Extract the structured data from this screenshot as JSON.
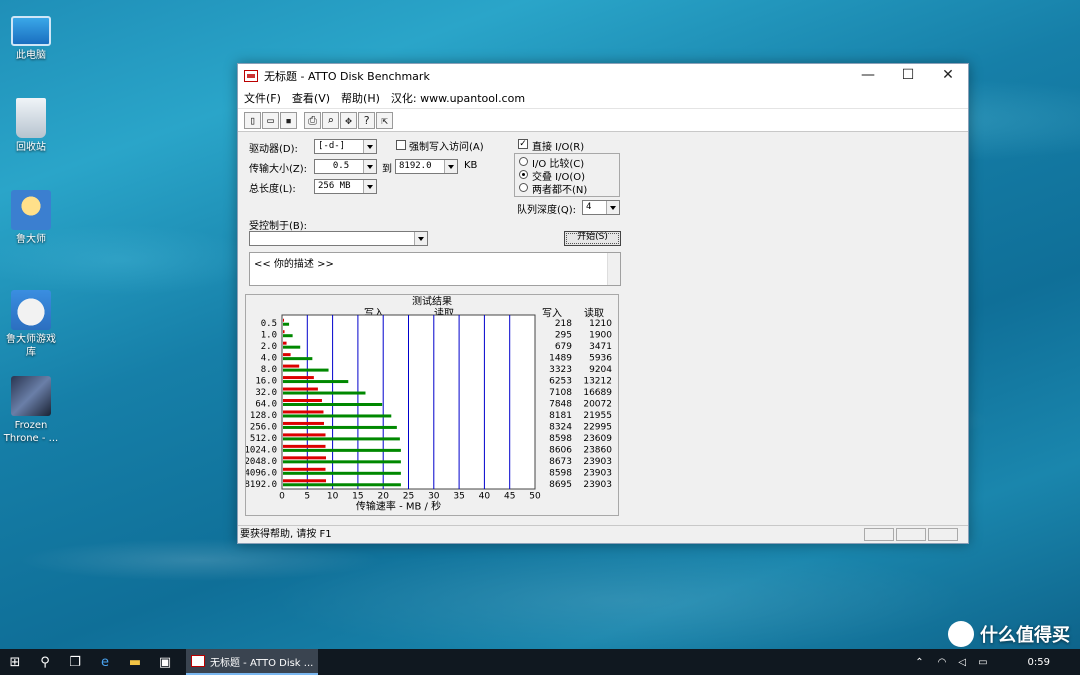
{
  "desktop": {
    "icons": [
      {
        "label": "此电脑",
        "icon": "computer-icon"
      },
      {
        "label": "回收站",
        "icon": "recycle-bin-icon"
      },
      {
        "label": "鲁大师",
        "icon": "ludashi-icon"
      },
      {
        "label": "鲁大师游戏库",
        "icon": "game-library-icon"
      },
      {
        "label": "Frozen Throne - ...",
        "icon": "frozen-throne-icon"
      }
    ]
  },
  "window": {
    "title": "无标题 - ATTO Disk Benchmark",
    "controls": {
      "minimize": "—",
      "maximize": "☐",
      "close": "✕"
    },
    "menu": [
      "文件(F)",
      "查看(V)",
      "帮助(H)",
      "汉化: www.upantool.com"
    ],
    "toolbar": [
      {
        "icon": "new-file-icon",
        "glyph": "▯"
      },
      {
        "icon": "open-folder-icon",
        "glyph": "▭"
      },
      {
        "icon": "save-icon",
        "glyph": "▪"
      },
      {
        "icon": "print-icon",
        "glyph": "⎙"
      },
      {
        "icon": "print-preview-icon",
        "glyph": "⌕"
      },
      {
        "icon": "move-icon",
        "glyph": "✥"
      },
      {
        "icon": "help-icon",
        "glyph": "?"
      },
      {
        "icon": "context-help-icon",
        "glyph": "⇱"
      }
    ],
    "form": {
      "drive_label": "驱动器(D):",
      "drive_value": "[-d-]",
      "force_write_label": "强制写入访问(A)",
      "transfer_size_label": "传输大小(Z):",
      "transfer_from": "0.5",
      "to_label": "到",
      "transfer_to": "8192.0",
      "kb_label": "KB",
      "total_length_label": "总长度(L):",
      "total_length_value": "256 MB",
      "direct_io_label": "直接 I/O(R)",
      "io_compare_label": "I/O 比较(C)",
      "overlap_io_label": "交叠 I/O(O)",
      "neither_label": "两者都不(N)",
      "queue_depth_label": "队列深度(Q):",
      "queue_depth_value": "4",
      "controlled_by_label": "受控制于(B):",
      "controlled_by_value": "",
      "start_button": "开始(S)",
      "description": "<<  你的描述  >>"
    },
    "status": "要获得帮助, 请按 F1"
  },
  "chart_data": {
    "type": "bar",
    "title": "测试结果",
    "xlabel": "传输速率 - MB / 秒",
    "xlim": [
      0,
      50
    ],
    "xticks": [
      "0",
      "5",
      "10",
      "15",
      "20",
      "25",
      "30",
      "35",
      "40",
      "45",
      "50"
    ],
    "categories": [
      "0.5",
      "1.0",
      "2.0",
      "4.0",
      "8.0",
      "16.0",
      "32.0",
      "64.0",
      "128.0",
      "256.0",
      "512.0",
      "1024.0",
      "2048.0",
      "4096.0",
      "8192.0"
    ],
    "series": [
      {
        "name": "写入",
        "color": "#dd0000",
        "values": [
          0.2,
          0.3,
          0.7,
          1.5,
          3.2,
          6.1,
          6.9,
          7.7,
          8.0,
          8.1,
          8.4,
          8.4,
          8.5,
          8.4,
          8.5
        ]
      },
      {
        "name": "读取",
        "color": "#008800",
        "values": [
          1.2,
          1.9,
          3.4,
          5.8,
          9.0,
          12.9,
          16.3,
          19.6,
          21.4,
          22.5,
          23.1,
          23.3,
          23.3,
          23.3,
          23.3
        ]
      }
    ],
    "table_headers": [
      "写入",
      "读取"
    ],
    "write_values": [
      "218",
      "295",
      "679",
      "1489",
      "3323",
      "6253",
      "7108",
      "7848",
      "8181",
      "8324",
      "8598",
      "8606",
      "8673",
      "8598",
      "8695"
    ],
    "read_values": [
      "1210",
      "1900",
      "3471",
      "5936",
      "9204",
      "13212",
      "16689",
      "20072",
      "21955",
      "22995",
      "23609",
      "23860",
      "23903",
      "23903",
      "23903"
    ],
    "grid": true
  },
  "taskbar": {
    "active_window": "无标题 - ATTO Disk ...",
    "time": "0:59"
  },
  "watermark": "什么值得买"
}
